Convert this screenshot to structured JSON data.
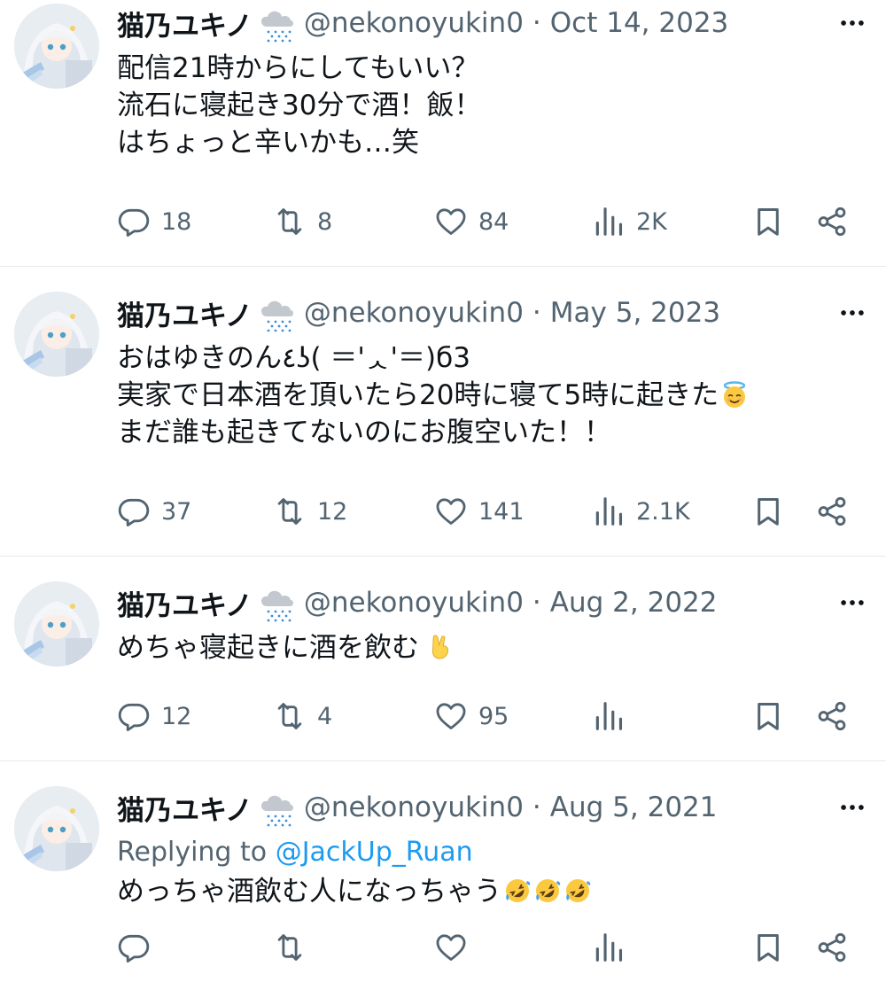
{
  "colors": {
    "text": "#0f1419",
    "muted": "#536471",
    "link": "#1d9bf0",
    "divider": "#e6e9ec"
  },
  "tweets": [
    {
      "name": "猫乃ユキノ",
      "handle": "@nekonoyukin0",
      "date": "Oct 14, 2023",
      "separator": "·",
      "text": "配信21時からにしてもいい？\n流石に寝起き30分で酒！飯！\nはちょっと辛いかも…笑",
      "replies": "18",
      "retweets": "8",
      "likes": "84",
      "views": "2K"
    },
    {
      "name": "猫乃ユキノ",
      "handle": "@nekonoyukin0",
      "date": "May 5, 2023",
      "separator": "·",
      "text": "おはゆきのん٤ʖ( ＝'ᆺ'＝)б3\n実家で日本酒を頂いたら20時に寝て5時に起きた",
      "text_line3": "まだ誰も起きてないのにお腹空いた！！",
      "emoji": "smiling-face-with-halo",
      "replies": "37",
      "retweets": "12",
      "likes": "141",
      "views": "2.1K"
    },
    {
      "name": "猫乃ユキノ",
      "handle": "@nekonoyukin0",
      "date": "Aug 2, 2022",
      "separator": "·",
      "text": "めちゃ寝起きに酒を飲む",
      "emoji": "victory-hand",
      "replies": "12",
      "retweets": "4",
      "likes": "95",
      "views": ""
    },
    {
      "name": "猫乃ユキノ",
      "handle": "@nekonoyukin0",
      "date": "Aug 5, 2021",
      "separator": "·",
      "replying_prefix": "Replying to",
      "replying_to": "@JackUp_Ruan",
      "text": "めっちゃ酒飲む人になっちゃう",
      "emoji": "rolling-on-the-floor-laughing",
      "replies": "",
      "retweets": "",
      "likes": "",
      "views": ""
    }
  ]
}
